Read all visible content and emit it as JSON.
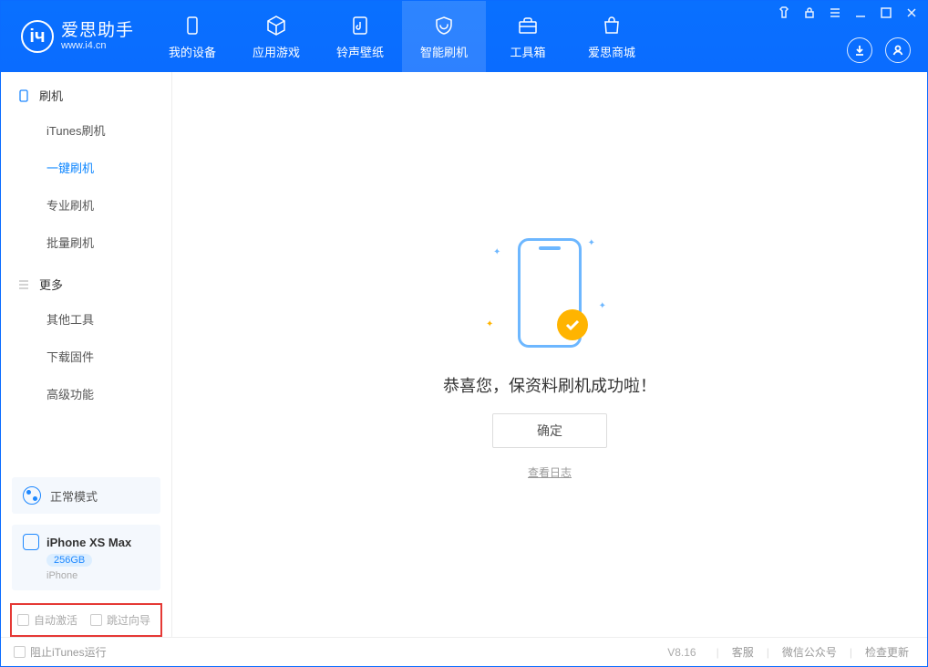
{
  "app": {
    "title": "爱思助手",
    "subtitle": "www.i4.cn"
  },
  "topnav": [
    {
      "label": "我的设备"
    },
    {
      "label": "应用游戏"
    },
    {
      "label": "铃声壁纸"
    },
    {
      "label": "智能刷机"
    },
    {
      "label": "工具箱"
    },
    {
      "label": "爱思商城"
    }
  ],
  "sidebar": {
    "section1": {
      "title": "刷机",
      "items": [
        "iTunes刷机",
        "一键刷机",
        "专业刷机",
        "批量刷机"
      ]
    },
    "section2": {
      "title": "更多",
      "items": [
        "其他工具",
        "下载固件",
        "高级功能"
      ]
    },
    "mode": "正常模式",
    "device": {
      "name": "iPhone XS Max",
      "storage": "256GB",
      "type": "iPhone"
    },
    "checkboxes": {
      "auto_activate": "自动激活",
      "skip_guide": "跳过向导"
    }
  },
  "main": {
    "success_message": "恭喜您，保资料刷机成功啦！",
    "ok_button": "确定",
    "view_log": "查看日志"
  },
  "footer": {
    "block_itunes": "阻止iTunes运行",
    "version": "V8.16",
    "links": [
      "客服",
      "微信公众号",
      "检查更新"
    ]
  }
}
